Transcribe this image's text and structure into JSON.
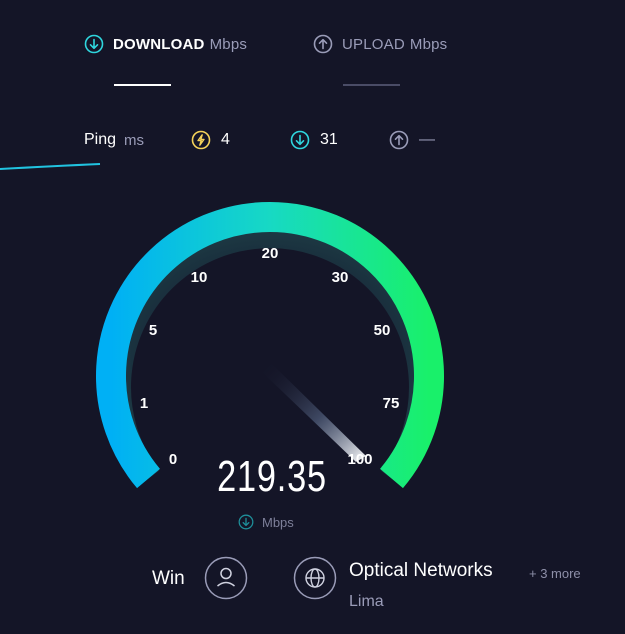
{
  "tabs": {
    "download": {
      "strong": "DOWNLOAD",
      "unit": "Mbps",
      "icon": "download-arrow-icon"
    },
    "upload": {
      "strong": "UPLOAD",
      "unit": "Mbps",
      "icon": "upload-arrow-icon"
    }
  },
  "ping": {
    "label": "Ping",
    "unit": "ms",
    "idle_value": "4",
    "download_value": "31",
    "upload_value": "—"
  },
  "gauge": {
    "tick_labels": [
      "0",
      "1",
      "5",
      "10",
      "20",
      "30",
      "50",
      "75",
      "100"
    ],
    "current_value": "219.35",
    "unit": "Mbps",
    "needle_position_fraction": 1.0
  },
  "provider": {
    "isp": "Win",
    "server": "Optical Networks",
    "server_more": "+ 3 more",
    "city": "Lima"
  },
  "colors": {
    "background": "#141527",
    "accent_cyan": "#00c8e8",
    "accent_green": "#19f06a",
    "ping_yellow": "#f5d35a",
    "muted": "#9a9cb8"
  }
}
